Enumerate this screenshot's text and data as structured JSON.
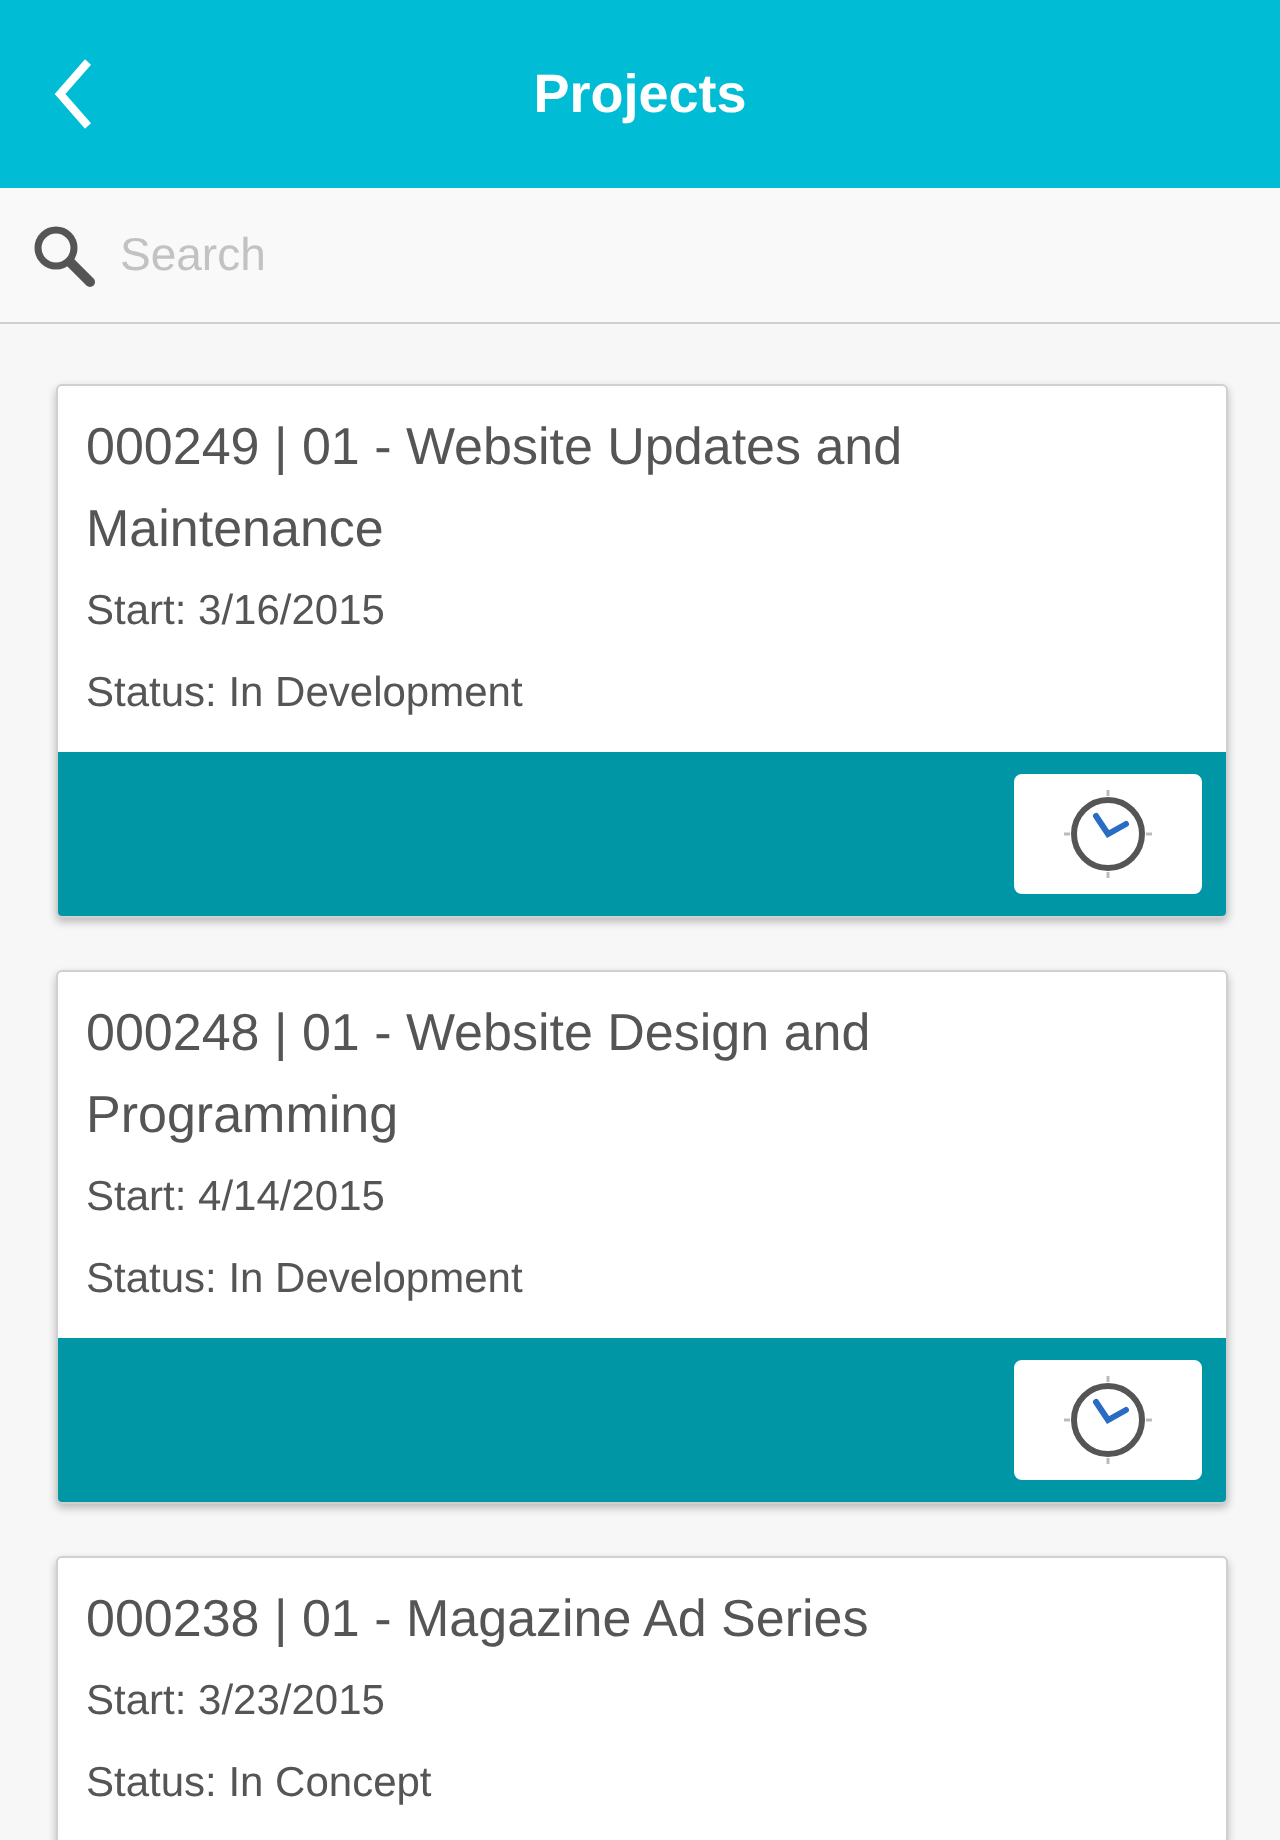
{
  "header": {
    "title": "Projects"
  },
  "search": {
    "placeholder": "Search"
  },
  "projects": [
    {
      "title": "000249 | 01 - Website Updates and Maintenance",
      "start": "Start: 3/16/2015",
      "status": "Status: In Development",
      "timer_shown": true
    },
    {
      "title": "000248 | 01 - Website Design and Programming",
      "start": "Start: 4/14/2015",
      "status": "Status: In Development",
      "timer_shown": true
    },
    {
      "title": "000238 | 01 - Magazine Ad Series",
      "start": "Start: 3/23/2015",
      "status": "Status: In Concept",
      "timer_shown": false
    }
  ]
}
